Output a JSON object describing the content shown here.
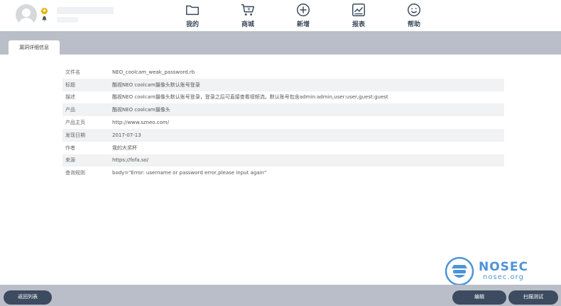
{
  "nav": {
    "items": [
      {
        "label": "我的",
        "icon": "folder-icon"
      },
      {
        "label": "商城",
        "icon": "cart-icon"
      },
      {
        "label": "新增",
        "icon": "plus-circle-icon"
      },
      {
        "label": "报表",
        "icon": "report-icon"
      },
      {
        "label": "帮助",
        "icon": "smile-icon"
      }
    ]
  },
  "tab": {
    "label": "漏洞详细信息"
  },
  "details": [
    {
      "key": "文件名",
      "value": "NEO_coolcam_weak_password.rb"
    },
    {
      "key": "标题",
      "value": "酷视NEO coolcam摄像头默认账号登录"
    },
    {
      "key": "描述",
      "value": "酷视NEO coolcam摄像头默认账号登录，登录之后可直接查看视频流。默认账号包含admin:admin,user:user,guest:guest"
    },
    {
      "key": "产品",
      "value": "酷视NEO coolcam摄像头"
    },
    {
      "key": "产品主页",
      "value": "http://www.szneo.com/"
    },
    {
      "key": "发现日期",
      "value": "2017-07-13"
    },
    {
      "key": "作者",
      "value": "我的大奖杯"
    },
    {
      "key": "来源",
      "value": "https://fofa.so/"
    },
    {
      "key": "查询规则",
      "value": "body=\"Error: username or password error,please input again\""
    }
  ],
  "watermark": {
    "title": "NOSEC",
    "domain": "nosec.org"
  },
  "buttons": {
    "back": "返回列表",
    "edit": "编辑",
    "scan": "扫描测试"
  },
  "colors": {
    "band": "#b9bec8",
    "button": "#3d4b61",
    "nav_text": "#3c4a5c",
    "watermark": "#4e93d8"
  }
}
